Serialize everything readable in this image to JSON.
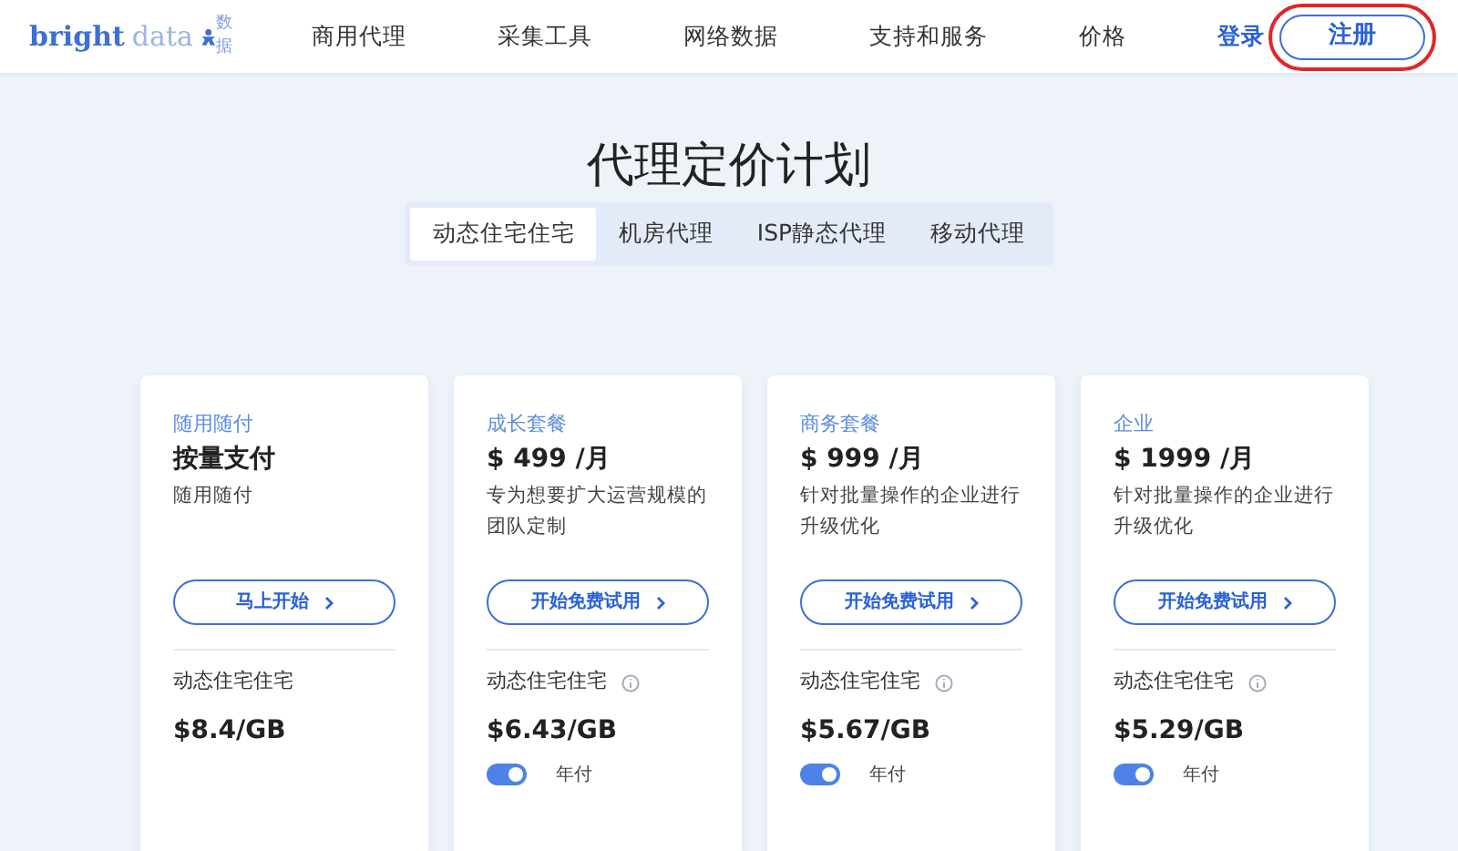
{
  "header": {
    "logo": {
      "word_1": "bright",
      "word_2": "data",
      "word_3": "数据"
    },
    "nav": [
      "商用代理",
      "采集工具",
      "网络数据",
      "支持和服务",
      "价格"
    ],
    "login": "登录",
    "signup": {
      "label": "注册",
      "highlighted": true
    }
  },
  "title": "代理定价计划",
  "tabs": [
    {
      "label": "动态住宅住宅",
      "selected": true
    },
    {
      "label": "机房代理",
      "selected": false
    },
    {
      "label": "ISP静态代理",
      "selected": false
    },
    {
      "label": "移动代理",
      "selected": false
    }
  ],
  "plans": [
    {
      "tier": "随用随付",
      "price": "按量支付",
      "description": "随用随付",
      "button": "马上开始",
      "product": "动态住宅住宅",
      "info": false,
      "rate": "$8.4/GB"
    },
    {
      "tier": "成长套餐",
      "price": "$ 499 /月",
      "description": "专为想要扩大运营规模的团队定制",
      "button": "开始免费试用",
      "product": "动态住宅住宅",
      "info": true,
      "rate": "$6.43/GB",
      "annual": {
        "label": "年付",
        "on": true
      }
    },
    {
      "tier": "商务套餐",
      "price": "$ 999 /月",
      "description": "针对批量操作的企业进行升级优化",
      "button": "开始免费试用",
      "product": "动态住宅住宅",
      "info": true,
      "rate": "$5.67/GB",
      "annual": {
        "label": "年付",
        "on": true
      }
    },
    {
      "tier": "企业",
      "price": "$ 1999 /月",
      "description": "针对批量操作的企业进行升级优化",
      "button": "开始免费试用",
      "product": "动态住宅住宅",
      "info": true,
      "rate": "$5.29/GB",
      "annual": {
        "label": "年付",
        "on": true
      }
    }
  ]
}
